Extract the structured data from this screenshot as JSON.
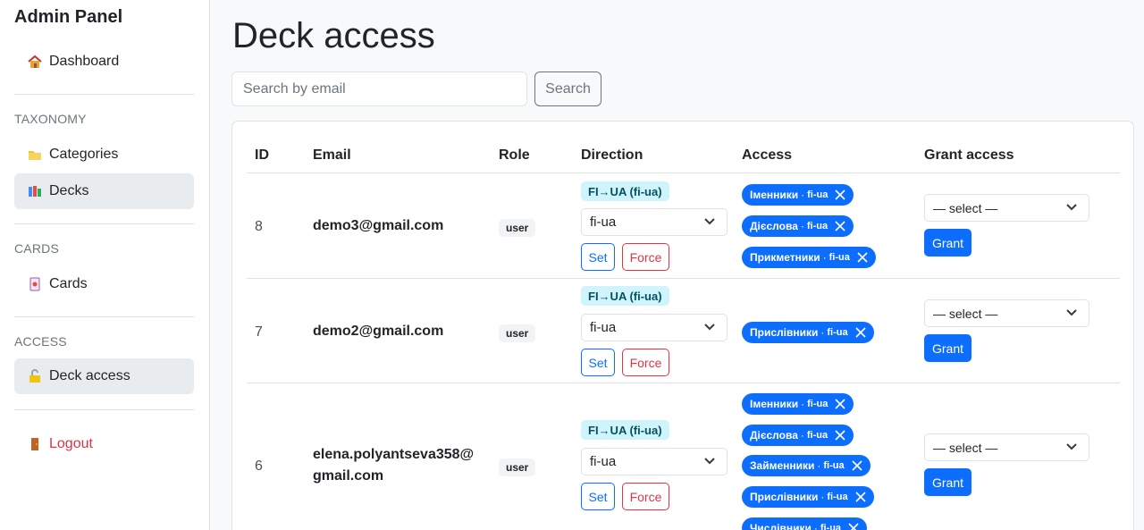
{
  "sidebar": {
    "brand": "Admin Panel",
    "dashboard": "Dashboard",
    "section_taxonomy": "TAXONOMY",
    "categories": "Categories",
    "decks": "Decks",
    "section_cards": "CARDS",
    "cards": "Cards",
    "section_access": "ACCESS",
    "deck_access": "Deck access",
    "logout": "Logout",
    "icons": [
      "house-icon",
      "folder-icon",
      "books-icon",
      "card-icon",
      "unlock-icon",
      "door-icon"
    ]
  },
  "page": {
    "title": "Deck access",
    "search_placeholder": "Search by email",
    "search_button": "Search"
  },
  "table": {
    "headers": [
      "ID",
      "Email",
      "Role",
      "Direction",
      "Access",
      "Grant access"
    ],
    "rows": [
      {
        "id": "8",
        "email": "demo3@gmail.com",
        "role": "user",
        "direction_badge": "FI→UA (fi-ua)",
        "direction_select": "fi-ua",
        "set": "Set",
        "force": "Force",
        "access": [
          {
            "name": "Іменники",
            "sep": "·",
            "code": "fi-ua"
          },
          {
            "name": "Дієслова",
            "sep": "·",
            "code": "fi-ua"
          },
          {
            "name": "Прикметники",
            "sep": "·",
            "code": "fi-ua"
          }
        ],
        "grant_select": "— select —",
        "grant_button": "Grant"
      },
      {
        "id": "7",
        "email": "demo2@gmail.com",
        "role": "user",
        "direction_badge": "FI→UA (fi-ua)",
        "direction_select": "fi-ua",
        "set": "Set",
        "force": "Force",
        "access": [
          {
            "name": "Прислівники",
            "sep": "·",
            "code": "fi-ua"
          }
        ],
        "grant_select": "— select —",
        "grant_button": "Grant"
      },
      {
        "id": "6",
        "email_line1": "elena.polyantseva358@",
        "email_line2": "gmail.com",
        "role": "user",
        "direction_badge": "FI→UA (fi-ua)",
        "direction_select": "fi-ua",
        "set": "Set",
        "force": "Force",
        "access": [
          {
            "name": "Іменники",
            "sep": "·",
            "code": "fi-ua"
          },
          {
            "name": "Дієслова",
            "sep": "·",
            "code": "fi-ua"
          },
          {
            "name": "Займенники",
            "sep": "·",
            "code": "fi-ua"
          },
          {
            "name": "Прислівники",
            "sep": "·",
            "code": "fi-ua"
          },
          {
            "name": "Числівники",
            "sep": "·",
            "code": "fi-ua"
          }
        ],
        "grant_select": "— select —",
        "grant_button": "Grant"
      }
    ]
  },
  "colors": {
    "primary": "#0d6efd",
    "danger": "#dc3545",
    "info_bg": "#cff4fc",
    "info_text": "#055160",
    "active_nav": "#e9ecef"
  }
}
